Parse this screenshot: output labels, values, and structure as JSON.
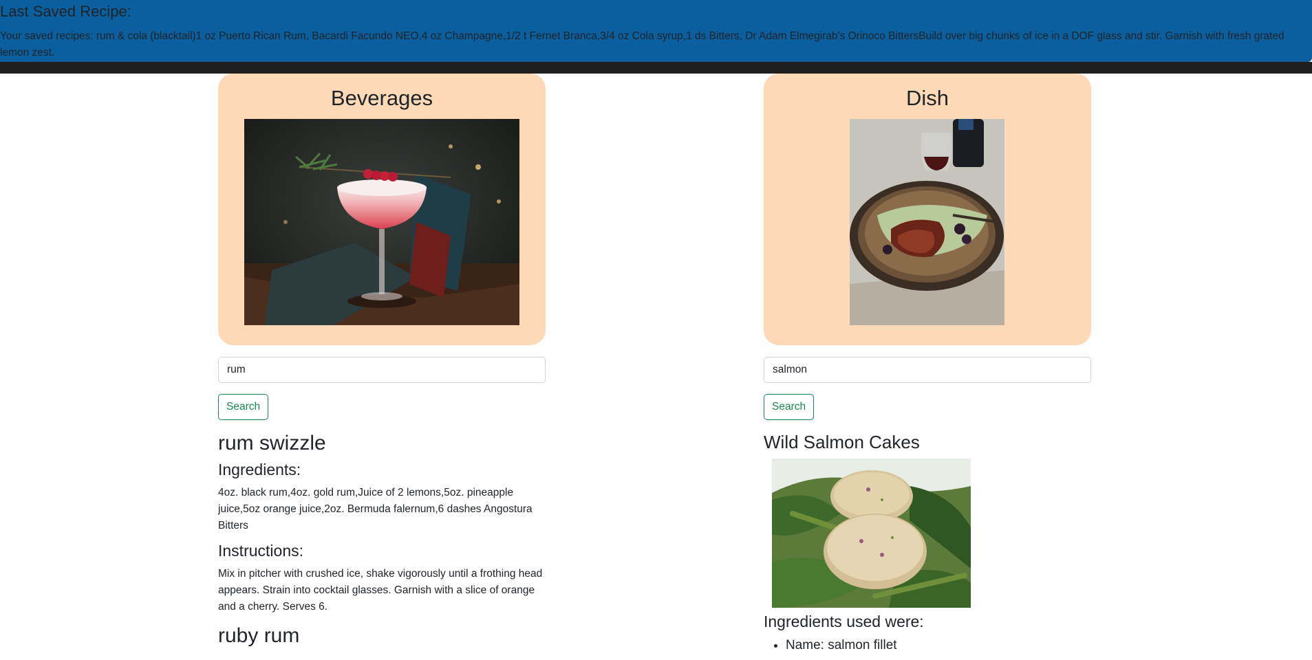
{
  "banner": {
    "title": "Last Saved Recipe:",
    "text": "Your saved recipes: rum & cola (blacktail)1 oz Puerto Rican Rum, Bacardi Facundo NEO,4 oz Champagne,1/2 t Fernet Branca,3/4 oz Cola syrup,1 ds Bitters, Dr Adam Elmegirab's Orinoco BittersBuild over big chunks of ice in a DOF glass and stir. Garnish with fresh grated lemon zest."
  },
  "beverages": {
    "title": "Beverages",
    "search_value": "rum",
    "search_label": "Search",
    "result": {
      "name": "rum swizzle",
      "ingredients_heading": "Ingredients:",
      "ingredients": "4oz. black rum,4oz. gold rum,Juice of 2 lemons,5oz. pineapple juice,5oz orange juice,2oz. Bermuda falernum,6 dashes Angostura Bitters",
      "instructions_heading": "Instructions:",
      "instructions": "Mix in pitcher with crushed ice, shake vigorously until a frothing head appears. Strain into cocktail glasses. Garnish with a slice of orange and a cherry. Serves 6.",
      "next_name": "ruby rum"
    }
  },
  "dish": {
    "title": "Dish",
    "search_value": "salmon",
    "search_label": "Search",
    "result": {
      "name": "Wild Salmon Cakes",
      "ingredients_heading": "Ingredients used were:",
      "ingredient_items": [
        "Name: salmon fillet"
      ]
    }
  },
  "colors": {
    "banner": "#0c5f9e",
    "card": "#fed9b7",
    "button": "#198754"
  }
}
